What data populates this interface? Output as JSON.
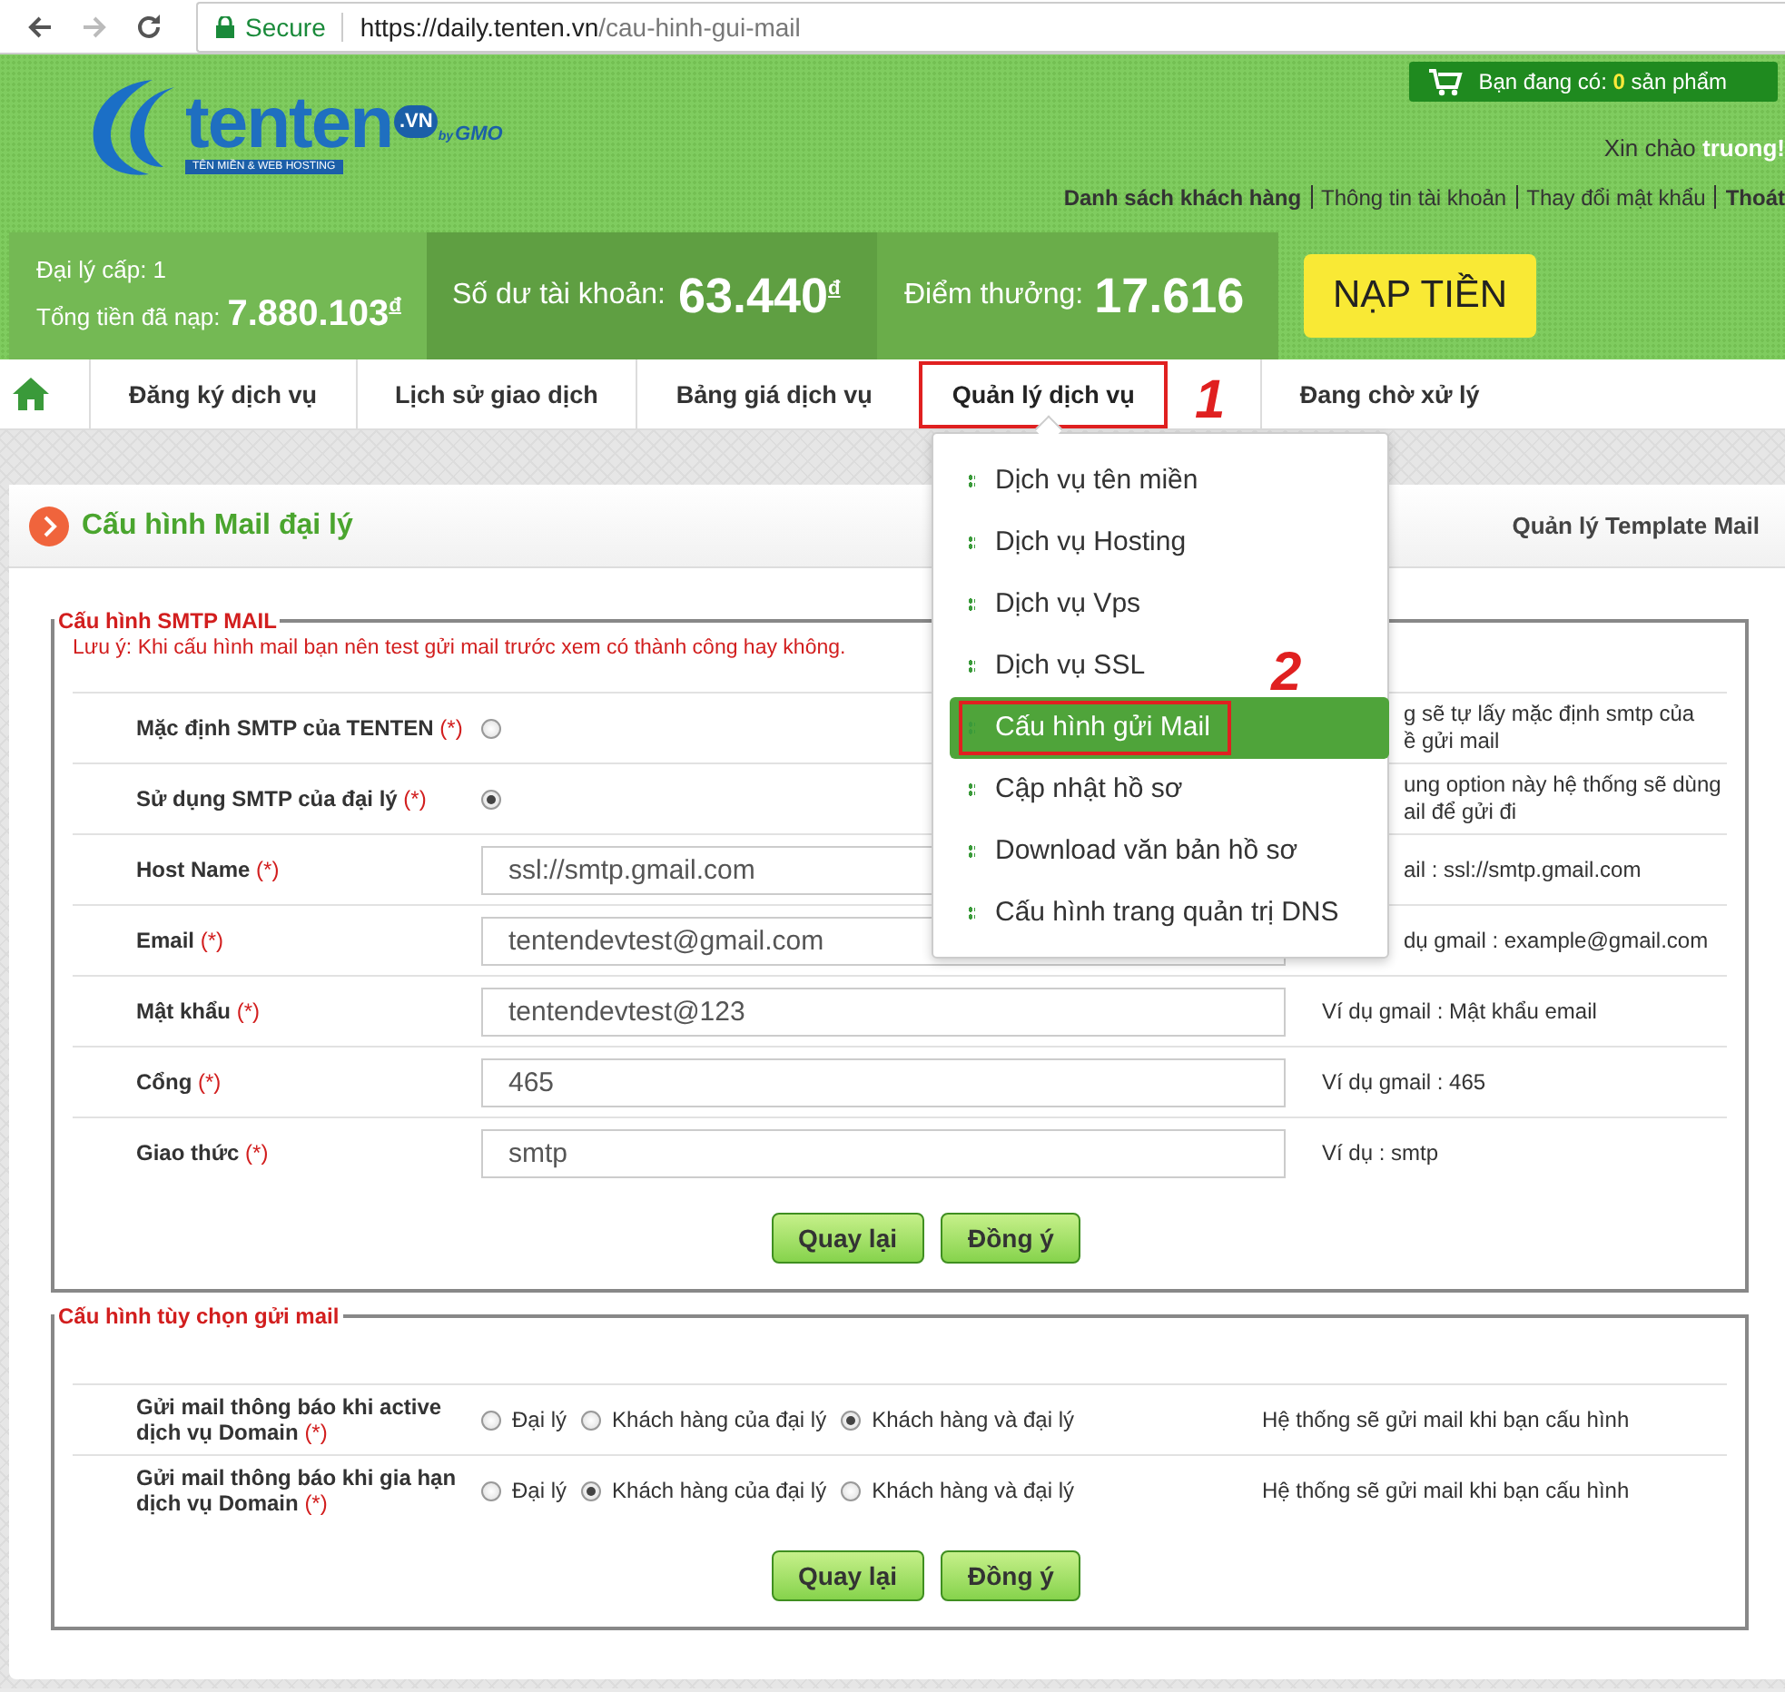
{
  "browser": {
    "secure": "Secure",
    "host": "https://daily.tenten.vn",
    "path": "/cau-hinh-gui-mail"
  },
  "header": {
    "logo": {
      "name": "tenten",
      "tld": ".VN",
      "by": "by",
      "gmo": "GMO",
      "tagline": "TÊN MIỀN & WEB HOSTING"
    },
    "cart": {
      "prefix": "Bạn đang có:",
      "count": "0",
      "suffix": "sản phẩm"
    },
    "greeting": {
      "prefix": "Xin chào",
      "user": "truong!"
    },
    "links": [
      {
        "label": "Danh sách khách hàng",
        "bold": true
      },
      {
        "label": "Thông tin tài khoản",
        "bold": false
      },
      {
        "label": "Thay đổi mật khẩu",
        "bold": false
      },
      {
        "label": "Thoát",
        "bold": true
      }
    ]
  },
  "stats": {
    "agent_level": "Đại lý cấp: 1",
    "total_label": "Tổng tiền đã nạp:",
    "total_value": "7.880.103",
    "currency_1": "đ",
    "balance_label": "Số dư tài khoản:",
    "balance_value": "63.440",
    "currency_2": "đ",
    "points_label": "Điểm thưởng:",
    "points_value": "17.616",
    "topup_button": "NẠP TIỀN"
  },
  "nav": {
    "items": [
      {
        "label": "Đăng ký dịch vụ",
        "selected": false,
        "circled": false
      },
      {
        "label": "Lịch sử giao dịch",
        "selected": false,
        "circled": false
      },
      {
        "label": "Bảng giá dịch vụ",
        "selected": false,
        "circled": false
      },
      {
        "label": "Quản lý dịch vụ",
        "selected": true,
        "circled": true
      },
      {
        "label": "Đang chờ xử lý",
        "selected": false,
        "circled": false
      }
    ]
  },
  "dropdown": {
    "items": [
      {
        "label": "Dịch vụ tên miền",
        "selected": false,
        "circled": false
      },
      {
        "label": "Dịch vụ Hosting",
        "selected": false,
        "circled": false
      },
      {
        "label": "Dịch vụ Vps",
        "selected": false,
        "circled": false
      },
      {
        "label": "Dịch vụ SSL",
        "selected": false,
        "circled": false
      },
      {
        "label": "Cấu hình gửi Mail",
        "selected": true,
        "circled": true
      },
      {
        "label": "Cập nhật hồ sơ",
        "selected": false,
        "circled": false
      },
      {
        "label": "Download văn bản hồ sơ",
        "selected": false,
        "circled": false
      },
      {
        "label": "Cấu hình trang quản trị DNS",
        "selected": false,
        "circled": false
      }
    ]
  },
  "annotations": [
    {
      "label": "1"
    },
    {
      "label": "2"
    }
  ],
  "panel": {
    "title": "Cấu hình Mail đại lý",
    "right_link": "Quản lý Template Mail"
  },
  "smtp_section": {
    "legend": "Cấu hình SMTP MAIL",
    "note": "Lưu ý: Khi cấu hình mail bạn nên test gửi mail trước xem có thành công hay không.",
    "rows": [
      {
        "kind": "radio",
        "label": "Mặc định SMTP của TENTEN",
        "required": "(*)",
        "selected": false,
        "note_clipped": true,
        "note_lines": [
          "g sẽ tự lấy mặc định smtp của",
          "ề gửi mail"
        ]
      },
      {
        "kind": "radio",
        "label": "Sử dụng SMTP của đại lý",
        "required": "(*)",
        "selected": true,
        "note_clipped": true,
        "note_lines": [
          "ung option này hệ thống sẽ dùng",
          "ail để gửi đi"
        ]
      },
      {
        "kind": "input",
        "label": "Host Name",
        "required": "(*)",
        "value": "ssl://smtp.gmail.com",
        "note_clipped": true,
        "note_lines": [
          "ail : ssl://smtp.gmail.com"
        ]
      },
      {
        "kind": "input",
        "label": "Email",
        "required": "(*)",
        "value": "tentendevtest@gmail.com",
        "note_clipped": true,
        "note_lines": [
          "dụ gmail : example@gmail.com"
        ]
      },
      {
        "kind": "input",
        "label": "Mật khẩu",
        "required": "(*)",
        "value": "tentendevtest@123",
        "note_clipped": false,
        "note_lines": [
          "Ví dụ gmail : Mật khẩu email"
        ]
      },
      {
        "kind": "input",
        "label": "Cổng",
        "required": "(*)",
        "value": "465",
        "note_clipped": false,
        "note_lines": [
          "Ví dụ gmail : 465"
        ]
      },
      {
        "kind": "input",
        "label": "Giao thức",
        "required": "(*)",
        "value": "smtp",
        "note_clipped": false,
        "note_lines": [
          "Ví dụ : smtp"
        ]
      }
    ],
    "buttons": [
      "Quay lại",
      "Đồng ý"
    ]
  },
  "options_section": {
    "legend": "Cấu hình tùy chọn gửi mail",
    "rows": [
      {
        "label_lines": [
          "Gửi mail thông báo khi active",
          "dịch vụ Domain"
        ],
        "required": "(*)",
        "options": [
          {
            "label": "Đại lý",
            "selected": false
          },
          {
            "label": "Khách hàng của đại lý",
            "selected": false
          },
          {
            "label": "Khách hàng và đại lý",
            "selected": true
          }
        ],
        "note": "Hệ thống sẽ gửi mail khi bạn cấu hình"
      },
      {
        "label_lines": [
          "Gửi mail thông báo khi gia hạn",
          "dịch vụ Domain"
        ],
        "required": "(*)",
        "options": [
          {
            "label": "Đại lý",
            "selected": false
          },
          {
            "label": "Khách hàng của đại lý",
            "selected": true
          },
          {
            "label": "Khách hàng và đại lý",
            "selected": false
          }
        ],
        "note": "Hệ thống sẽ gửi mail khi bạn cấu hình"
      }
    ],
    "buttons": [
      "Quay lại",
      "Đồng ý"
    ]
  }
}
